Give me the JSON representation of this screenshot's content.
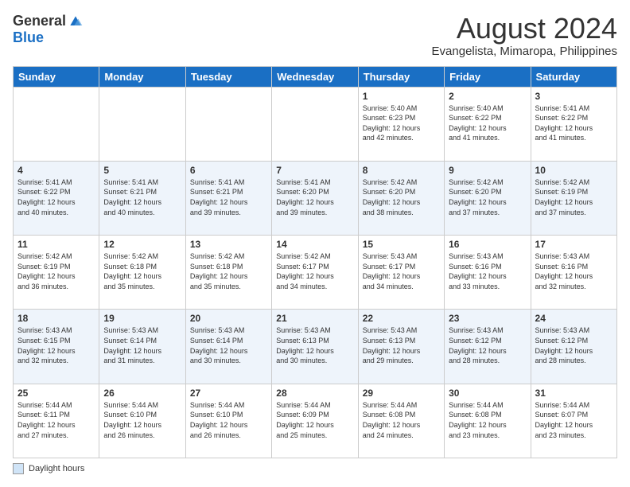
{
  "logo": {
    "general": "General",
    "blue": "Blue"
  },
  "title": "August 2024",
  "location": "Evangelista, Mimaropa, Philippines",
  "days_of_week": [
    "Sunday",
    "Monday",
    "Tuesday",
    "Wednesday",
    "Thursday",
    "Friday",
    "Saturday"
  ],
  "footer_label": "Daylight hours",
  "weeks": [
    [
      {
        "day": "",
        "info": ""
      },
      {
        "day": "",
        "info": ""
      },
      {
        "day": "",
        "info": ""
      },
      {
        "day": "",
        "info": ""
      },
      {
        "day": "1",
        "info": "Sunrise: 5:40 AM\nSunset: 6:23 PM\nDaylight: 12 hours\nand 42 minutes."
      },
      {
        "day": "2",
        "info": "Sunrise: 5:40 AM\nSunset: 6:22 PM\nDaylight: 12 hours\nand 41 minutes."
      },
      {
        "day": "3",
        "info": "Sunrise: 5:41 AM\nSunset: 6:22 PM\nDaylight: 12 hours\nand 41 minutes."
      }
    ],
    [
      {
        "day": "4",
        "info": "Sunrise: 5:41 AM\nSunset: 6:22 PM\nDaylight: 12 hours\nand 40 minutes."
      },
      {
        "day": "5",
        "info": "Sunrise: 5:41 AM\nSunset: 6:21 PM\nDaylight: 12 hours\nand 40 minutes."
      },
      {
        "day": "6",
        "info": "Sunrise: 5:41 AM\nSunset: 6:21 PM\nDaylight: 12 hours\nand 39 minutes."
      },
      {
        "day": "7",
        "info": "Sunrise: 5:41 AM\nSunset: 6:20 PM\nDaylight: 12 hours\nand 39 minutes."
      },
      {
        "day": "8",
        "info": "Sunrise: 5:42 AM\nSunset: 6:20 PM\nDaylight: 12 hours\nand 38 minutes."
      },
      {
        "day": "9",
        "info": "Sunrise: 5:42 AM\nSunset: 6:20 PM\nDaylight: 12 hours\nand 37 minutes."
      },
      {
        "day": "10",
        "info": "Sunrise: 5:42 AM\nSunset: 6:19 PM\nDaylight: 12 hours\nand 37 minutes."
      }
    ],
    [
      {
        "day": "11",
        "info": "Sunrise: 5:42 AM\nSunset: 6:19 PM\nDaylight: 12 hours\nand 36 minutes."
      },
      {
        "day": "12",
        "info": "Sunrise: 5:42 AM\nSunset: 6:18 PM\nDaylight: 12 hours\nand 35 minutes."
      },
      {
        "day": "13",
        "info": "Sunrise: 5:42 AM\nSunset: 6:18 PM\nDaylight: 12 hours\nand 35 minutes."
      },
      {
        "day": "14",
        "info": "Sunrise: 5:42 AM\nSunset: 6:17 PM\nDaylight: 12 hours\nand 34 minutes."
      },
      {
        "day": "15",
        "info": "Sunrise: 5:43 AM\nSunset: 6:17 PM\nDaylight: 12 hours\nand 34 minutes."
      },
      {
        "day": "16",
        "info": "Sunrise: 5:43 AM\nSunset: 6:16 PM\nDaylight: 12 hours\nand 33 minutes."
      },
      {
        "day": "17",
        "info": "Sunrise: 5:43 AM\nSunset: 6:16 PM\nDaylight: 12 hours\nand 32 minutes."
      }
    ],
    [
      {
        "day": "18",
        "info": "Sunrise: 5:43 AM\nSunset: 6:15 PM\nDaylight: 12 hours\nand 32 minutes."
      },
      {
        "day": "19",
        "info": "Sunrise: 5:43 AM\nSunset: 6:14 PM\nDaylight: 12 hours\nand 31 minutes."
      },
      {
        "day": "20",
        "info": "Sunrise: 5:43 AM\nSunset: 6:14 PM\nDaylight: 12 hours\nand 30 minutes."
      },
      {
        "day": "21",
        "info": "Sunrise: 5:43 AM\nSunset: 6:13 PM\nDaylight: 12 hours\nand 30 minutes."
      },
      {
        "day": "22",
        "info": "Sunrise: 5:43 AM\nSunset: 6:13 PM\nDaylight: 12 hours\nand 29 minutes."
      },
      {
        "day": "23",
        "info": "Sunrise: 5:43 AM\nSunset: 6:12 PM\nDaylight: 12 hours\nand 28 minutes."
      },
      {
        "day": "24",
        "info": "Sunrise: 5:43 AM\nSunset: 6:12 PM\nDaylight: 12 hours\nand 28 minutes."
      }
    ],
    [
      {
        "day": "25",
        "info": "Sunrise: 5:44 AM\nSunset: 6:11 PM\nDaylight: 12 hours\nand 27 minutes."
      },
      {
        "day": "26",
        "info": "Sunrise: 5:44 AM\nSunset: 6:10 PM\nDaylight: 12 hours\nand 26 minutes."
      },
      {
        "day": "27",
        "info": "Sunrise: 5:44 AM\nSunset: 6:10 PM\nDaylight: 12 hours\nand 26 minutes."
      },
      {
        "day": "28",
        "info": "Sunrise: 5:44 AM\nSunset: 6:09 PM\nDaylight: 12 hours\nand 25 minutes."
      },
      {
        "day": "29",
        "info": "Sunrise: 5:44 AM\nSunset: 6:08 PM\nDaylight: 12 hours\nand 24 minutes."
      },
      {
        "day": "30",
        "info": "Sunrise: 5:44 AM\nSunset: 6:08 PM\nDaylight: 12 hours\nand 23 minutes."
      },
      {
        "day": "31",
        "info": "Sunrise: 5:44 AM\nSunset: 6:07 PM\nDaylight: 12 hours\nand 23 minutes."
      }
    ]
  ]
}
